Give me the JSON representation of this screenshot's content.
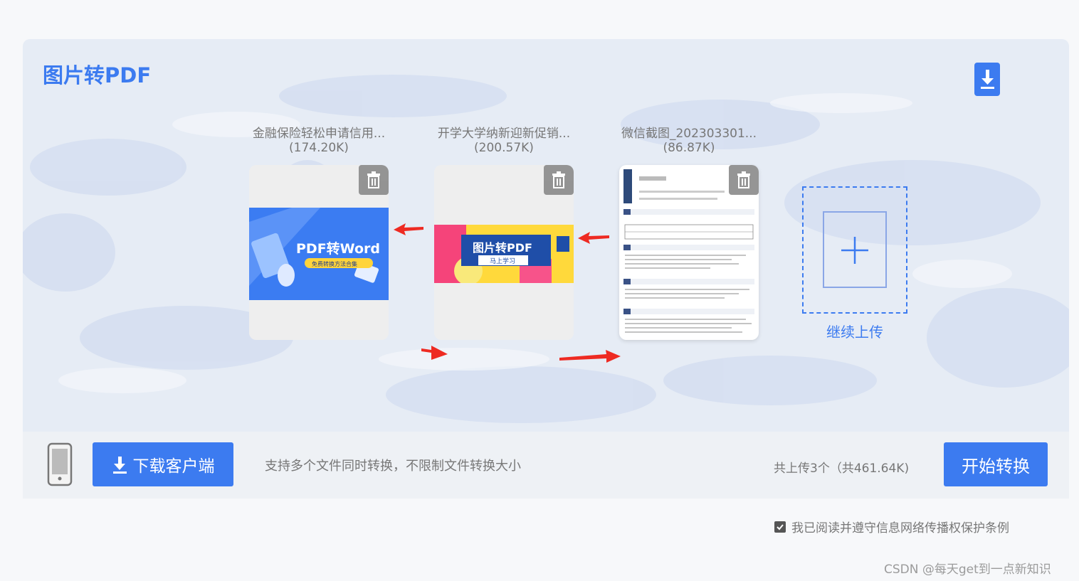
{
  "panel": {
    "title": "图片转PDF",
    "download_icon": "download-icon"
  },
  "files": [
    {
      "name": "金融保险轻松申请信用...",
      "size": "(174.20K)",
      "thumb_text": "PDF转Word",
      "thumb_sub": "免费转换方法合集"
    },
    {
      "name": "开学大学纳新迎新促销...",
      "size": "(200.57K)",
      "thumb_text": "图片转PDF",
      "thumb_sub": "马上学习"
    },
    {
      "name": "微信截图_202303301...",
      "size": "(86.87K)"
    }
  ],
  "upload": {
    "label": "继续上传",
    "icon": "plus-icon"
  },
  "bottom": {
    "download_client_label": "下载客户端",
    "support_text": "支持多个文件同时转换，不限制文件转换大小",
    "upload_count": "共上传3个（共461.64K)",
    "start_label": "开始转换"
  },
  "agreement": {
    "checked": true,
    "text": "我已阅读并遵守信息网络传播权保护条例"
  },
  "watermark": "CSDN @每天get到一点新知识",
  "colors": {
    "accent": "#3c7bf0",
    "arrow": "#ee2a22",
    "panel_bg": "#e6ecf5"
  }
}
